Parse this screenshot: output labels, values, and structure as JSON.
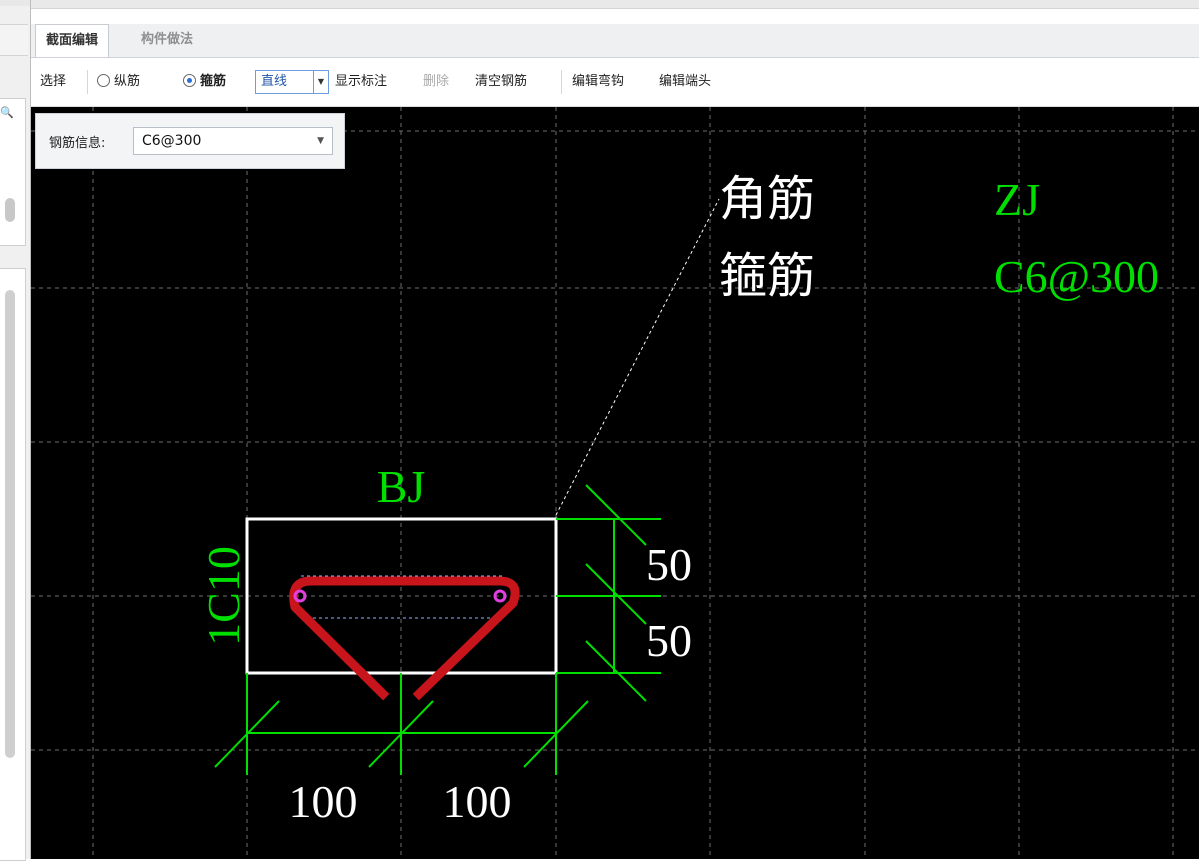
{
  "tabs": [
    {
      "label": "截面编辑",
      "active": true
    },
    {
      "label": "构件做法",
      "active": false
    }
  ],
  "toolbar": {
    "select_label": "选择",
    "radio_longitudinal": "纵筋",
    "radio_stirrup": "箍筋",
    "stirrup_selected": true,
    "draw_mode": "直线",
    "show_dim": "显示标注",
    "delete": "删除",
    "clear_rebar": "清空钢筋",
    "edit_hook": "编辑弯钩",
    "edit_end": "编辑端头"
  },
  "rebar_info": {
    "label": "钢筋信息:",
    "value": "C6@300"
  },
  "canvas": {
    "background": "#000000",
    "grid": true,
    "annotation": {
      "line1_cn": "角筋",
      "line2_cn": "箍筋",
      "line1_code": "ZJ",
      "line2_code": "C6@300"
    },
    "top_label": "BJ",
    "side_label": "1C10",
    "dims_vertical": [
      "50",
      "50"
    ],
    "dims_horizontal": [
      "100",
      "100"
    ],
    "colors": {
      "dimension": "#00e000",
      "section_outline": "#ffffff",
      "stirrup": "#c8141b",
      "node": "#e040e0",
      "text_white": "#ffffff",
      "text_green": "#00e000"
    }
  }
}
